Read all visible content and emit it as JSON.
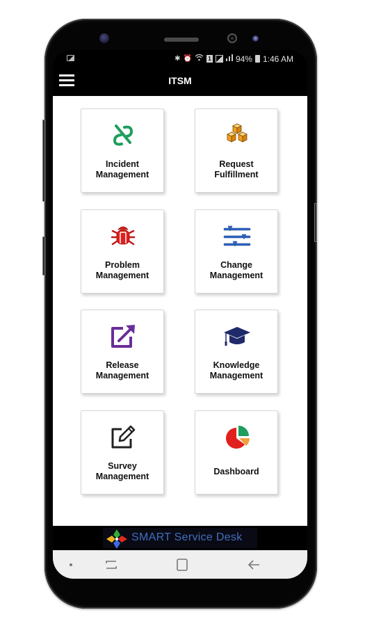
{
  "statusbar": {
    "battery_percent": "94%",
    "time": "1:46 AM",
    "sim_label": "1",
    "icons": [
      "gallery-icon",
      "bluetooth-icon",
      "alarm-icon",
      "wifi-icon",
      "sim-icon",
      "signal-icon",
      "battery-icon"
    ]
  },
  "appbar": {
    "title": "ITSM",
    "menu_icon": "hamburger-menu-icon"
  },
  "tiles": [
    {
      "line1": "Incident",
      "line2": "Management",
      "icon": "broken-link-icon",
      "color": "#1e9e5e"
    },
    {
      "line1": "Request",
      "line2": "Fulfillment",
      "icon": "boxes-icon",
      "color": "#f0a020"
    },
    {
      "line1": "Problem",
      "line2": "Management",
      "icon": "bug-icon",
      "color": "#e0201c"
    },
    {
      "line1": "Change",
      "line2": "Management",
      "icon": "sliders-icon",
      "color": "#2e66c8"
    },
    {
      "line1": "Release",
      "line2": "Management",
      "icon": "external-link-icon",
      "color": "#6a2e9a"
    },
    {
      "line1": "Knowledge",
      "line2": "Management",
      "icon": "graduation-cap-icon",
      "color": "#1f2a6a"
    },
    {
      "line1": "Survey",
      "line2": "Management",
      "icon": "edit-pencil-icon",
      "color": "#222222"
    },
    {
      "line1": "Dashboard",
      "line2": "",
      "icon": "pie-chart-icon",
      "color": "#e0201c"
    }
  ],
  "brand": {
    "text": "SMART Service Desk",
    "color": "#3f6fc0"
  },
  "navbar": {
    "recents": "recents-icon",
    "home": "home-icon",
    "back": "back-icon"
  }
}
